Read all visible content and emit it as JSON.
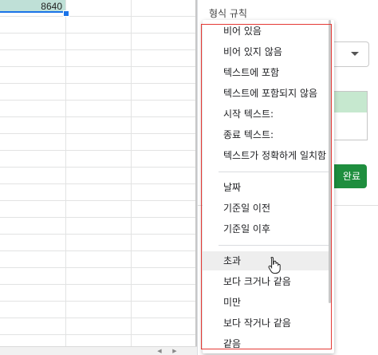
{
  "sheet": {
    "selected_cell_value": "8640"
  },
  "panel": {
    "section_title": "형식 규칙",
    "done_button_partial": "완료"
  },
  "menu": {
    "groups": [
      [
        "비어 있음",
        "비어 있지 않음",
        "텍스트에 포함",
        "텍스트에 포함되지 않음",
        "시작 텍스트:",
        "종료 텍스트:",
        "텍스트가 정확하게 일치함"
      ],
      [
        "날짜",
        "기준일 이전",
        "기준일 이후"
      ],
      [
        "초과",
        "보다 크거나 같음",
        "미만",
        "보다 작거나 같음",
        "같음"
      ]
    ],
    "hovered_item": "초과"
  },
  "colors": {
    "highlight_border": "#e53935",
    "selected_cell_bg": "#bfe0d7",
    "done_button_bg": "#1e8e3e",
    "hover_bg": "#eeeeee"
  }
}
